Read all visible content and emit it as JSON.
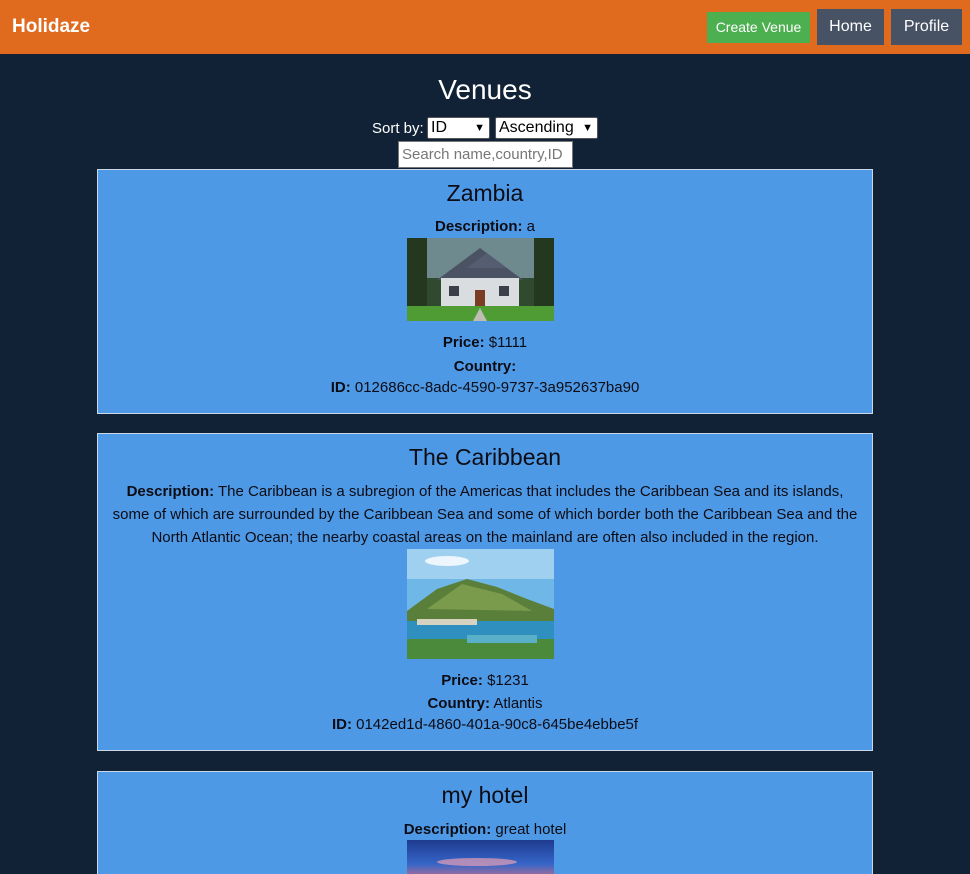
{
  "app": {
    "brand": "Holidaze",
    "nav": {
      "create_label": "Create Venue",
      "home_label": "Home",
      "profile_label": "Profile"
    }
  },
  "main": {
    "title": "Venues",
    "sort_label": "Sort by:",
    "sort_field": "ID",
    "sort_order": "Ascending",
    "search_placeholder": "Search name,country,ID"
  },
  "labels": {
    "description": "Description:",
    "price": "Price:",
    "country": "Country:",
    "id": "ID:"
  },
  "venues": [
    {
      "name": "Zambia",
      "description": "a",
      "price": "$1111",
      "country": "",
      "id": "012686cc-8adc-4590-9737-3a952637ba90",
      "image": "house-photo"
    },
    {
      "name": "The Caribbean",
      "description": "The Caribbean is a subregion of the Americas that includes the Caribbean Sea and its islands, some of which are surrounded by the Caribbean Sea and some of which border both the Caribbean Sea and the North Atlantic Ocean; the nearby coastal areas on the mainland are often also included in the region.",
      "price": "$1231",
      "country": "Atlantis",
      "id": "0142ed1d-4860-401a-90c8-645be4ebbe5f",
      "image": "island-coast-photo"
    },
    {
      "name": "my hotel",
      "description": "great hotel",
      "image": "sunset-sky-photo"
    }
  ],
  "colors": {
    "header": "#e06a1d",
    "background": "#112236",
    "card": "#4e99e6",
    "create_button": "#4cb050",
    "nav_button": "#475264"
  }
}
